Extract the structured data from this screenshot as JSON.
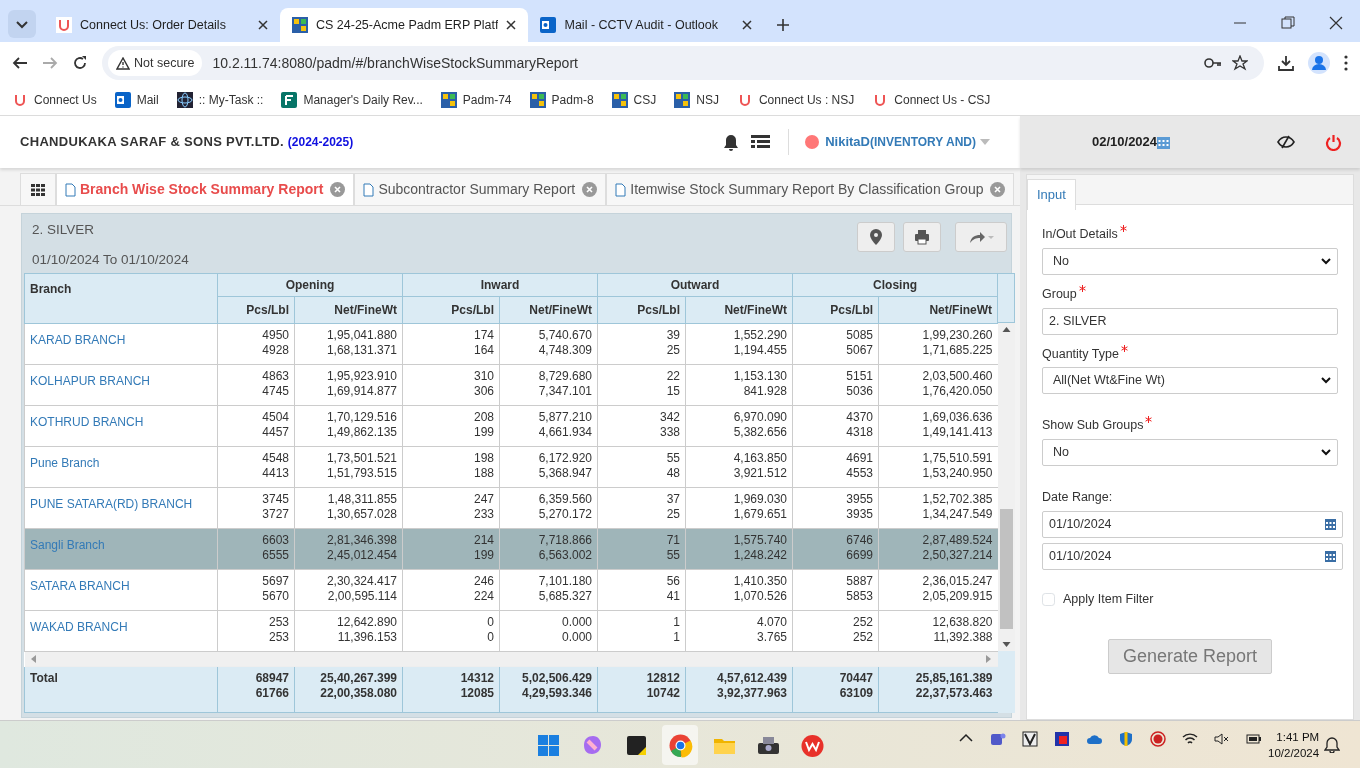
{
  "browser": {
    "tabs": [
      {
        "title": "Connect Us: Order Details",
        "selected": false
      },
      {
        "title": "CS 24-25-Acme Padm ERP Platf",
        "selected": true
      },
      {
        "title": "Mail - CCTV Audit - Outlook",
        "selected": false
      }
    ],
    "security": "Not secure",
    "url": "10.2.11.74:8080/padm/#/branchWiseStockSummaryReport",
    "bookmarks": [
      "Connect Us",
      "Mail",
      ":: My-Task ::",
      "Manager's Daily Rev...",
      "Padm-74",
      "Padm-8",
      "CSJ",
      "NSJ",
      "Connect Us : NSJ",
      "Connect Us - CSJ"
    ]
  },
  "app": {
    "company": "CHANDUKAKA SARAF & SONS PVT.LTD.",
    "year": "(2024-2025)",
    "user": "NikitaD",
    "role": "(INVENTORY AND)",
    "date": "02/10/2024"
  },
  "report_tabs": [
    {
      "title": "Branch Wise Stock Summary Report",
      "selected": true
    },
    {
      "title": "Subcontractor Summary Report",
      "selected": false
    },
    {
      "title": "Itemwise Stock Summary Report By Classification Group",
      "selected": false
    }
  ],
  "report": {
    "group": "2. SILVER",
    "range": "01/10/2024 To 01/10/2024",
    "branch_heading": "Branch",
    "groups": [
      "Opening",
      "Inward",
      "Outward",
      "Closing"
    ],
    "sub_columns": [
      "Pcs/Lbl",
      "Net/FineWt",
      "Pcs/Lbl",
      "Net/FineWt",
      "Pcs/Lbl",
      "Net/FineWt",
      "Pcs/Lbl",
      "Net/FineWt"
    ],
    "rows": [
      {
        "branch": "KARAD BRANCH",
        "selected": false,
        "net": [
          "4950",
          "1,95,041.880",
          "174",
          "5,740.670",
          "39",
          "1,552.290",
          "5085",
          "1,99,230.260"
        ],
        "fine": [
          "4928",
          "1,68,131.371",
          "164",
          "4,748.309",
          "25",
          "1,194.455",
          "5067",
          "1,71,685.225"
        ]
      },
      {
        "branch": "KOLHAPUR BRANCH",
        "selected": false,
        "net": [
          "4863",
          "1,95,923.910",
          "310",
          "8,729.680",
          "22",
          "1,153.130",
          "5151",
          "2,03,500.460"
        ],
        "fine": [
          "4745",
          "1,69,914.877",
          "306",
          "7,347.101",
          "15",
          "841.928",
          "5036",
          "1,76,420.050"
        ]
      },
      {
        "branch": "KOTHRUD BRANCH",
        "selected": false,
        "net": [
          "4504",
          "1,70,129.516",
          "208",
          "5,877.210",
          "342",
          "6,970.090",
          "4370",
          "1,69,036.636"
        ],
        "fine": [
          "4457",
          "1,49,862.135",
          "199",
          "4,661.934",
          "338",
          "5,382.656",
          "4318",
          "1,49,141.413"
        ]
      },
      {
        "branch": "Pune Branch",
        "selected": false,
        "net": [
          "4548",
          "1,73,501.521",
          "198",
          "6,172.920",
          "55",
          "4,163.850",
          "4691",
          "1,75,510.591"
        ],
        "fine": [
          "4413",
          "1,51,793.515",
          "188",
          "5,368.947",
          "48",
          "3,921.512",
          "4553",
          "1,53,240.950"
        ]
      },
      {
        "branch": "PUNE SATARA(RD) BRANCH",
        "selected": false,
        "net": [
          "3745",
          "1,48,311.855",
          "247",
          "6,359.560",
          "37",
          "1,969.030",
          "3955",
          "1,52,702.385"
        ],
        "fine": [
          "3727",
          "1,30,657.028",
          "233",
          "5,270.172",
          "25",
          "1,679.651",
          "3935",
          "1,34,247.549"
        ]
      },
      {
        "branch": "Sangli Branch",
        "selected": true,
        "net": [
          "6603",
          "2,81,346.398",
          "214",
          "7,718.866",
          "71",
          "1,575.740",
          "6746",
          "2,87,489.524"
        ],
        "fine": [
          "6555",
          "2,45,012.454",
          "199",
          "6,563.002",
          "55",
          "1,248.242",
          "6699",
          "2,50,327.214"
        ]
      },
      {
        "branch": "SATARA BRANCH",
        "selected": false,
        "net": [
          "5697",
          "2,30,324.417",
          "246",
          "7,101.180",
          "56",
          "1,410.350",
          "5887",
          "2,36,015.247"
        ],
        "fine": [
          "5670",
          "2,00,595.114",
          "224",
          "5,685.327",
          "41",
          "1,070.526",
          "5853",
          "2,05,209.915"
        ]
      },
      {
        "branch": "WAKAD BRANCH",
        "selected": false,
        "net": [
          "253",
          "12,642.890",
          "0",
          "0.000",
          "1",
          "4.070",
          "252",
          "12,638.820"
        ],
        "fine": [
          "253",
          "11,396.153",
          "0",
          "0.000",
          "1",
          "3.765",
          "252",
          "11,392.388"
        ]
      }
    ],
    "total": {
      "label": "Total",
      "net": [
        "68947",
        "25,40,267.399",
        "14312",
        "5,02,506.429",
        "12812",
        "4,57,612.439",
        "70447",
        "25,85,161.389"
      ],
      "fine": [
        "61766",
        "22,00,358.080",
        "12085",
        "4,29,593.346",
        "10742",
        "3,92,377.963",
        "63109",
        "22,37,573.463"
      ]
    }
  },
  "input_panel": {
    "tab": "Input",
    "fields": [
      {
        "kind": "select",
        "label": "In/Out Details",
        "required": true,
        "value": "No"
      },
      {
        "kind": "text",
        "label": "Group",
        "required": true,
        "value": "2. SILVER"
      },
      {
        "kind": "select",
        "label": "Quantity Type",
        "required": true,
        "value": "All(Net Wt&Fine Wt)"
      },
      {
        "kind": "select",
        "label": "Show Sub Groups",
        "required": true,
        "value": "No"
      },
      {
        "kind": "dates",
        "label": "Date Range:",
        "required": false,
        "values": [
          "01/10/2024",
          "01/10/2024"
        ]
      }
    ],
    "checkbox": {
      "label": "Apply Item Filter",
      "checked": false
    },
    "button": "Generate Report"
  },
  "taskbar": {
    "time": "1:41 PM",
    "date": "10/2/2024"
  }
}
